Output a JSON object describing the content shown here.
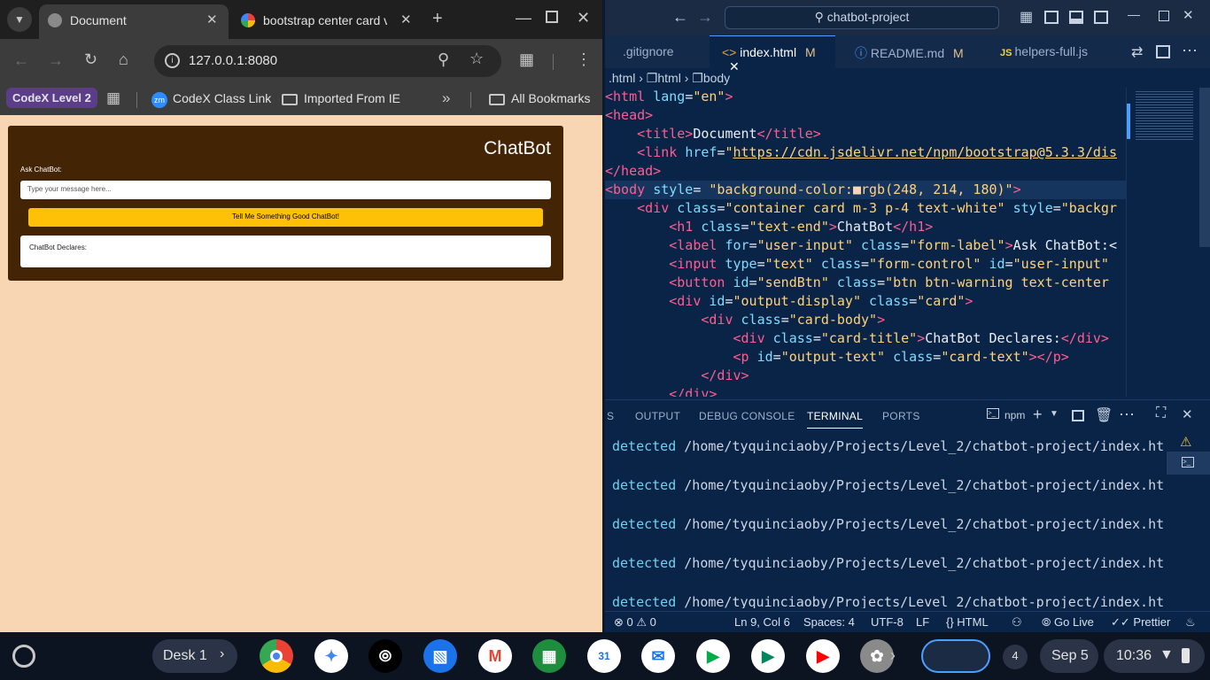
{
  "chrome": {
    "tabs": [
      {
        "title": "Document"
      },
      {
        "title": "bootstrap center card ve"
      }
    ],
    "url": "127.0.0.1:8080",
    "bookmarks": {
      "profile": "CodeX Level 2",
      "items": [
        "CodeX Class Link",
        "Imported From IE"
      ],
      "all": "All Bookmarks"
    },
    "page": {
      "title": "ChatBot",
      "label": "Ask ChatBot:",
      "placeholder": "Type your message here...",
      "button": "Tell Me Something Good ChatBot!",
      "output_title": "ChatBot Declares:",
      "bg": "#f8d6b4",
      "card_bg": "#432405",
      "button_color": "#ffc107"
    }
  },
  "vscode": {
    "search": "chatbot-project",
    "tabs": [
      ".gitignore",
      "index.html",
      "README.md",
      "helpers-full.js"
    ],
    "tab_badges": {
      "index": "M",
      "readme": "M"
    },
    "breadcrumb": [
      ".html",
      "html",
      "body"
    ],
    "code": [
      {
        "parts": [
          [
            "t",
            "<html "
          ],
          [
            "a",
            "lang"
          ],
          [
            "p",
            "="
          ],
          [
            "s",
            "\"en\""
          ],
          [
            "t",
            ">"
          ]
        ]
      },
      {
        "parts": [
          [
            "t",
            "<head>"
          ]
        ]
      },
      {
        "parts": [
          [
            "p",
            "    "
          ],
          [
            "t",
            "<title>"
          ],
          [
            "p",
            "Document"
          ],
          [
            "t",
            "</title>"
          ]
        ]
      },
      {
        "parts": [
          [
            "p",
            "    "
          ],
          [
            "t",
            "<link "
          ],
          [
            "a",
            "href"
          ],
          [
            "p",
            "="
          ],
          [
            "s",
            "\""
          ],
          [
            "u",
            "https://cdn.jsdelivr.net/npm/bootstrap@5.3.3/dis"
          ]
        ]
      },
      {
        "parts": [
          [
            "t",
            "</head>"
          ]
        ]
      },
      {
        "parts": [
          [
            "t",
            "<body "
          ],
          [
            "a",
            "style"
          ],
          [
            "p",
            "= "
          ],
          [
            "s",
            "\"background-color:"
          ],
          [
            "p",
            "■"
          ],
          [
            "s",
            "rgb(248, 214, 180)\""
          ],
          [
            "t",
            ">"
          ]
        ]
      },
      {
        "parts": [
          [
            "p",
            "    "
          ],
          [
            "t",
            "<div "
          ],
          [
            "a",
            "class"
          ],
          [
            "p",
            "="
          ],
          [
            "s",
            "\"container card m-3 p-4 text-white\" "
          ],
          [
            "a",
            "style"
          ],
          [
            "p",
            "="
          ],
          [
            "s",
            "\"backgr"
          ]
        ]
      },
      {
        "parts": [
          [
            "p",
            "        "
          ],
          [
            "t",
            "<h1 "
          ],
          [
            "a",
            "class"
          ],
          [
            "p",
            "="
          ],
          [
            "s",
            "\"text-end\""
          ],
          [
            "t",
            ">"
          ],
          [
            "p",
            "ChatBot"
          ],
          [
            "t",
            "</h1>"
          ]
        ]
      },
      {
        "parts": [
          [
            "p",
            "        "
          ],
          [
            "t",
            "<label "
          ],
          [
            "a",
            "for"
          ],
          [
            "p",
            "="
          ],
          [
            "s",
            "\"user-input\" "
          ],
          [
            "a",
            "class"
          ],
          [
            "p",
            "="
          ],
          [
            "s",
            "\"form-label\""
          ],
          [
            "t",
            ">"
          ],
          [
            "p",
            "Ask ChatBot:<"
          ]
        ]
      },
      {
        "parts": [
          [
            "p",
            "        "
          ],
          [
            "t",
            "<input "
          ],
          [
            "a",
            "type"
          ],
          [
            "p",
            "="
          ],
          [
            "s",
            "\"text\" "
          ],
          [
            "a",
            "class"
          ],
          [
            "p",
            "="
          ],
          [
            "s",
            "\"form-control\" "
          ],
          [
            "a",
            "id"
          ],
          [
            "p",
            "="
          ],
          [
            "s",
            "\"user-input\""
          ]
        ]
      },
      {
        "parts": [
          [
            "p",
            "        "
          ],
          [
            "t",
            "<button "
          ],
          [
            "a",
            "id"
          ],
          [
            "p",
            "="
          ],
          [
            "s",
            "\"sendBtn\" "
          ],
          [
            "a",
            "class"
          ],
          [
            "p",
            "="
          ],
          [
            "s",
            "\"btn btn-warning text-center"
          ]
        ]
      },
      {
        "parts": [
          [
            "p",
            "        "
          ],
          [
            "t",
            "<div "
          ],
          [
            "a",
            "id"
          ],
          [
            "p",
            "="
          ],
          [
            "s",
            "\"output-display\" "
          ],
          [
            "a",
            "class"
          ],
          [
            "p",
            "="
          ],
          [
            "s",
            "\"card\""
          ],
          [
            "t",
            ">"
          ]
        ]
      },
      {
        "parts": [
          [
            "p",
            "            "
          ],
          [
            "t",
            "<div "
          ],
          [
            "a",
            "class"
          ],
          [
            "p",
            "="
          ],
          [
            "s",
            "\"card-body\""
          ],
          [
            "t",
            ">"
          ]
        ]
      },
      {
        "parts": [
          [
            "p",
            "                "
          ],
          [
            "t",
            "<div "
          ],
          [
            "a",
            "class"
          ],
          [
            "p",
            "="
          ],
          [
            "s",
            "\"card-title\""
          ],
          [
            "t",
            ">"
          ],
          [
            "p",
            "ChatBot Declares:"
          ],
          [
            "t",
            "</div>"
          ]
        ]
      },
      {
        "parts": [
          [
            "p",
            "                "
          ],
          [
            "t",
            "<p "
          ],
          [
            "a",
            "id"
          ],
          [
            "p",
            "="
          ],
          [
            "s",
            "\"output-text\" "
          ],
          [
            "a",
            "class"
          ],
          [
            "p",
            "="
          ],
          [
            "s",
            "\"card-text\""
          ],
          [
            "t",
            "></p>"
          ]
        ]
      },
      {
        "parts": [
          [
            "p",
            "            "
          ],
          [
            "t",
            "</div>"
          ]
        ]
      },
      {
        "parts": [
          [
            "p",
            "        "
          ],
          [
            "t",
            "</div>"
          ]
        ]
      }
    ],
    "panel_tabs": [
      "S",
      "OUTPUT",
      "DEBUG CONSOLE",
      "TERMINAL",
      "PORTS"
    ],
    "terminal_profile": "npm",
    "terminal_lines": [
      {
        "kw": "detected",
        "path": "/home/tyquinciaoby/Projects/Level_2/chatbot-project/index.ht"
      },
      {
        "kw": "detected",
        "path": "/home/tyquinciaoby/Projects/Level_2/chatbot-project/index.ht"
      },
      {
        "kw": "detected",
        "path": "/home/tyquinciaoby/Projects/Level_2/chatbot-project/index.ht"
      },
      {
        "kw": "detected",
        "path": "/home/tyquinciaoby/Projects/Level_2/chatbot-project/index.ht"
      },
      {
        "kw": "detected",
        "path": "/home/tyquinciaoby/Projects/Level_2/chatbot-project/index.ht"
      }
    ],
    "status": {
      "errors": "0",
      "warnings": "0",
      "position": "Ln 9, Col 6",
      "spaces": "Spaces: 4",
      "encoding": "UTF-8",
      "eol": "LF",
      "lang": "HTML",
      "golive": "Go Live",
      "prettier": "Prettier"
    }
  },
  "shelf": {
    "desk": "Desk 1",
    "notifications": "4",
    "date": "Sep 5",
    "time": "10:36"
  }
}
